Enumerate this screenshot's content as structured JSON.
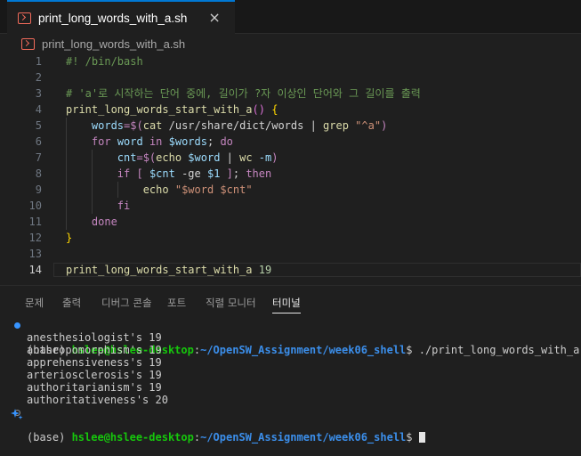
{
  "tab": {
    "title": "print_long_words_with_a.sh",
    "close": "×"
  },
  "breadcrumb": {
    "file": "print_long_words_with_a.sh"
  },
  "editor": {
    "line_numbers": [
      "1",
      "2",
      "3",
      "4",
      "5",
      "6",
      "7",
      "8",
      "9",
      "10",
      "11",
      "12",
      "13",
      "14"
    ],
    "lines": [
      [
        {
          "t": "#! /bin/bash",
          "c": "c-comment"
        }
      ],
      [],
      [
        {
          "t": "# 'a'로 시작하는 단어 중에, 길이가 ?자 이상인 단어와 그 길이를 출력",
          "c": "c-comment"
        }
      ],
      [
        {
          "t": "print_long_words_start_with_a",
          "c": "c-fn"
        },
        {
          "t": "()",
          "c": "c-brace2"
        },
        {
          "t": " ",
          "c": "c-plain"
        },
        {
          "t": "{",
          "c": "c-brace"
        }
      ],
      [
        {
          "t": "    ",
          "c": "c-plain"
        },
        {
          "t": "words",
          "c": "c-var"
        },
        {
          "t": "=$(",
          "c": "c-kw"
        },
        {
          "t": "cat",
          "c": "c-fn"
        },
        {
          "t": " /usr/share/dict/words ",
          "c": "c-plain"
        },
        {
          "t": "|",
          "c": "c-op"
        },
        {
          "t": " grep ",
          "c": "c-fn"
        },
        {
          "t": "\"^a\"",
          "c": "c-str"
        },
        {
          "t": ")",
          "c": "c-kw"
        }
      ],
      [
        {
          "t": "    ",
          "c": "c-plain"
        },
        {
          "t": "for",
          "c": "c-kw"
        },
        {
          "t": " word ",
          "c": "c-var"
        },
        {
          "t": "in",
          "c": "c-kw"
        },
        {
          "t": " $words",
          "c": "c-var"
        },
        {
          "t": "; ",
          "c": "c-plain"
        },
        {
          "t": "do",
          "c": "c-kw"
        }
      ],
      [
        {
          "t": "        ",
          "c": "c-plain"
        },
        {
          "t": "cnt",
          "c": "c-var"
        },
        {
          "t": "=$(",
          "c": "c-kw"
        },
        {
          "t": "echo",
          "c": "c-fn"
        },
        {
          "t": " $word",
          "c": "c-var"
        },
        {
          "t": " | ",
          "c": "c-plain"
        },
        {
          "t": "wc",
          "c": "c-fn"
        },
        {
          "t": " -m",
          "c": "c-var"
        },
        {
          "t": ")",
          "c": "c-kw"
        }
      ],
      [
        {
          "t": "        ",
          "c": "c-plain"
        },
        {
          "t": "if",
          "c": "c-kw"
        },
        {
          "t": " [ ",
          "c": "c-kw"
        },
        {
          "t": "$cnt",
          "c": "c-var"
        },
        {
          "t": " -ge ",
          "c": "c-plain"
        },
        {
          "t": "$1",
          "c": "c-var"
        },
        {
          "t": " ]",
          "c": "c-kw"
        },
        {
          "t": "; ",
          "c": "c-plain"
        },
        {
          "t": "then",
          "c": "c-kw"
        }
      ],
      [
        {
          "t": "            ",
          "c": "c-plain"
        },
        {
          "t": "echo",
          "c": "c-fn"
        },
        {
          "t": " ",
          "c": "c-plain"
        },
        {
          "t": "\"$word $cnt\"",
          "c": "c-str"
        }
      ],
      [
        {
          "t": "        ",
          "c": "c-plain"
        },
        {
          "t": "fi",
          "c": "c-kw"
        }
      ],
      [
        {
          "t": "    ",
          "c": "c-plain"
        },
        {
          "t": "done",
          "c": "c-kw"
        }
      ],
      [
        {
          "t": "}",
          "c": "c-brace"
        }
      ],
      [],
      [
        {
          "t": "print_long_words_start_with_a",
          "c": "c-fn"
        },
        {
          "t": " 19",
          "c": "c-num"
        }
      ]
    ]
  },
  "panel": {
    "tabs": [
      "문제",
      "출력",
      "디버그 콘솔",
      "포트",
      "직렬 모니터",
      "터미널"
    ],
    "active_tab": "터미널"
  },
  "terminal": {
    "prompt_prefix": "(base) ",
    "user_host": "hslee@hslee-desktop",
    "colon": ":",
    "path": "~/OpenSW_Assignment/week06_shell",
    "dollar": "$ ",
    "command": "./print_long_words_with_a.sh",
    "output": [
      "anesthesiologist's 19",
      "anthropomorphism's 19",
      "apprehensiveness's 19",
      "arteriosclerosis's 19",
      "authoritarianism's 19",
      "authoritativeness's 20"
    ]
  },
  "colors": {
    "accent": "#0078d4",
    "user": "#16c60c",
    "path": "#3b8eea",
    "shell_icon": "#f26b5b"
  },
  "icons": [
    "shell-file-icon",
    "close-icon",
    "sparkle-icon"
  ]
}
